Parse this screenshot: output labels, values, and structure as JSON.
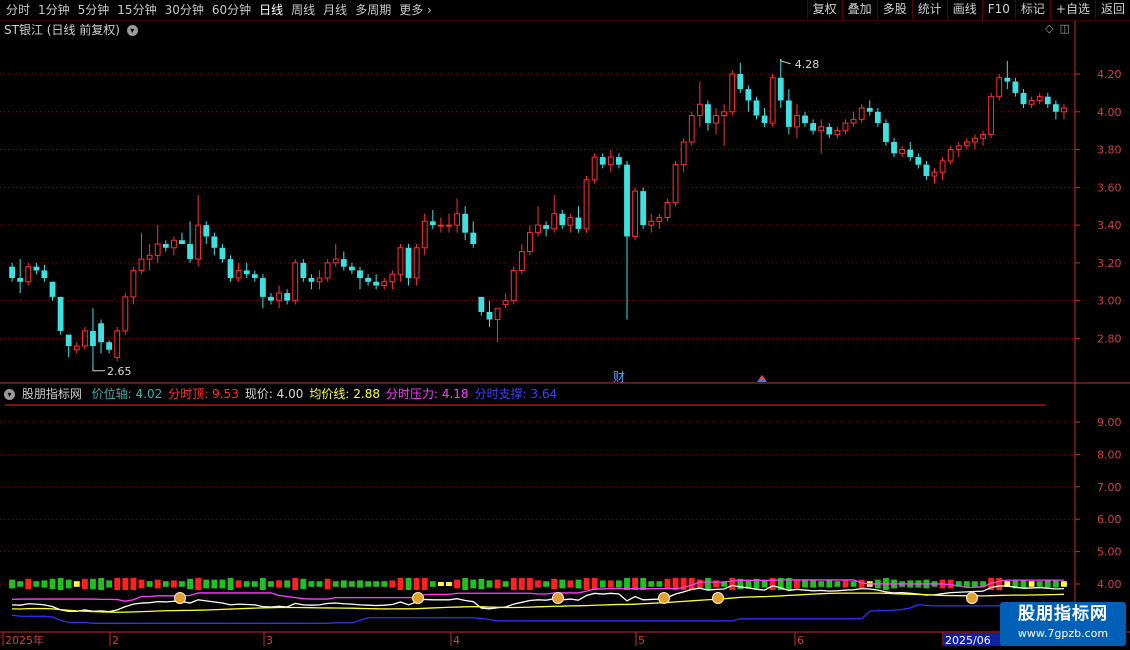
{
  "toolbar": {
    "periods": [
      "分时",
      "1分钟",
      "5分钟",
      "15分钟",
      "30分钟",
      "60分钟",
      "日线",
      "周线",
      "月线",
      "多周期",
      "更多"
    ],
    "active_period": "日线",
    "right_buttons": [
      "复权",
      "叠加",
      "多股",
      "统计",
      "画线",
      "F10",
      "标记",
      "+自选",
      "返回"
    ]
  },
  "chart_title": "ST银江 (日线 前复权)",
  "indicator": {
    "name": "股朋指标网",
    "items": [
      {
        "label": "价位轴: 4.02",
        "color": "#40b0b0"
      },
      {
        "label": "分时顶: 9.53",
        "color": "#ff3030"
      },
      {
        "label": "现价: 4.00",
        "color": "#d8d8d8"
      },
      {
        "label": "均价线: 2.88",
        "color": "#ffff40"
      },
      {
        "label": "分时压力: 4.18",
        "color": "#ff40ff"
      },
      {
        "label": "分时支撑: 3.64",
        "color": "#4040ff"
      }
    ]
  },
  "colors": {
    "up": "#ff3030",
    "down": "#40e0e0",
    "grid": "#7a0000",
    "axis": "#c03030"
  },
  "chart_data": {
    "type": "candlestick",
    "price_axis": {
      "ticks": [
        "4.20",
        "4.00",
        "3.80",
        "3.60",
        "3.40",
        "3.20",
        "3.00",
        "2.80"
      ],
      "ylim": [
        2.58,
        4.38
      ]
    },
    "indicator_axis": {
      "ticks": [
        "9.00",
        "8.00",
        "7.00",
        "6.00",
        "5.00",
        "4.00"
      ]
    },
    "x_labels": [
      "2025年",
      "2",
      "3",
      "4",
      "5",
      "6",
      "2025/06"
    ],
    "annotations": {
      "high": "4.28",
      "low": "2.65",
      "event": "财"
    },
    "candles": [
      [
        3.18,
        3.2,
        3.1,
        3.12
      ],
      [
        3.12,
        3.22,
        3.04,
        3.1
      ],
      [
        3.1,
        3.2,
        3.08,
        3.18
      ],
      [
        3.18,
        3.2,
        3.14,
        3.16
      ],
      [
        3.16,
        3.19,
        3.1,
        3.12
      ],
      [
        3.1,
        3.1,
        3.0,
        3.02
      ],
      [
        3.02,
        3.02,
        2.82,
        2.84
      ],
      [
        2.82,
        2.82,
        2.7,
        2.76
      ],
      [
        2.74,
        2.78,
        2.72,
        2.76
      ],
      [
        2.76,
        2.86,
        2.74,
        2.84
      ],
      [
        2.84,
        2.96,
        2.65,
        2.76
      ],
      [
        2.88,
        2.9,
        2.72,
        2.78
      ],
      [
        2.78,
        2.79,
        2.72,
        2.74
      ],
      [
        2.7,
        2.86,
        2.68,
        2.84
      ],
      [
        2.84,
        3.04,
        2.82,
        3.02
      ],
      [
        3.02,
        3.18,
        2.98,
        3.16
      ],
      [
        3.16,
        3.36,
        3.14,
        3.22
      ],
      [
        3.22,
        3.3,
        3.16,
        3.24
      ],
      [
        3.24,
        3.4,
        3.2,
        3.3
      ],
      [
        3.3,
        3.32,
        3.26,
        3.28
      ],
      [
        3.28,
        3.34,
        3.24,
        3.32
      ],
      [
        3.32,
        3.36,
        3.3,
        3.3
      ],
      [
        3.3,
        3.42,
        3.2,
        3.22
      ],
      [
        3.22,
        3.56,
        3.18,
        3.4
      ],
      [
        3.4,
        3.42,
        3.3,
        3.34
      ],
      [
        3.34,
        3.36,
        3.24,
        3.28
      ],
      [
        3.28,
        3.3,
        3.2,
        3.22
      ],
      [
        3.22,
        3.24,
        3.1,
        3.12
      ],
      [
        3.12,
        3.2,
        3.1,
        3.16
      ],
      [
        3.16,
        3.2,
        3.12,
        3.14
      ],
      [
        3.14,
        3.16,
        3.1,
        3.12
      ],
      [
        3.12,
        3.14,
        2.96,
        3.02
      ],
      [
        3.02,
        3.04,
        2.98,
        3.0
      ],
      [
        3.0,
        3.08,
        2.96,
        3.04
      ],
      [
        3.04,
        3.06,
        2.98,
        3.0
      ],
      [
        3.0,
        3.22,
        2.98,
        3.2
      ],
      [
        3.2,
        3.22,
        3.1,
        3.12
      ],
      [
        3.12,
        3.14,
        3.06,
        3.1
      ],
      [
        3.1,
        3.16,
        3.06,
        3.12
      ],
      [
        3.12,
        3.22,
        3.1,
        3.2
      ],
      [
        3.2,
        3.3,
        3.18,
        3.22
      ],
      [
        3.22,
        3.26,
        3.16,
        3.18
      ],
      [
        3.18,
        3.2,
        3.14,
        3.16
      ],
      [
        3.16,
        3.18,
        3.06,
        3.12
      ],
      [
        3.12,
        3.14,
        3.08,
        3.1
      ],
      [
        3.1,
        3.14,
        3.06,
        3.08
      ],
      [
        3.08,
        3.12,
        3.06,
        3.1
      ],
      [
        3.1,
        3.16,
        3.06,
        3.14
      ],
      [
        3.14,
        3.3,
        3.1,
        3.28
      ],
      [
        3.28,
        3.3,
        3.08,
        3.12
      ],
      [
        3.12,
        3.3,
        3.08,
        3.28
      ],
      [
        3.28,
        3.46,
        3.24,
        3.42
      ],
      [
        3.42,
        3.48,
        3.38,
        3.4
      ],
      [
        3.4,
        3.44,
        3.36,
        3.4
      ],
      [
        3.4,
        3.46,
        3.36,
        3.4
      ],
      [
        3.4,
        3.54,
        3.36,
        3.46
      ],
      [
        3.46,
        3.5,
        3.32,
        3.36
      ],
      [
        3.36,
        3.42,
        3.28,
        3.3
      ],
      [
        3.02,
        3.02,
        2.92,
        2.94
      ],
      [
        2.94,
        3.0,
        2.86,
        2.9
      ],
      [
        2.9,
        2.94,
        2.78,
        2.96
      ],
      [
        2.98,
        3.04,
        2.96,
        3.0
      ],
      [
        3.0,
        3.18,
        2.98,
        3.16
      ],
      [
        3.16,
        3.3,
        3.14,
        3.26
      ],
      [
        3.26,
        3.4,
        3.24,
        3.36
      ],
      [
        3.36,
        3.5,
        3.34,
        3.4
      ],
      [
        3.4,
        3.42,
        3.34,
        3.38
      ],
      [
        3.38,
        3.56,
        3.36,
        3.46
      ],
      [
        3.46,
        3.48,
        3.38,
        3.4
      ],
      [
        3.4,
        3.46,
        3.36,
        3.44
      ],
      [
        3.44,
        3.5,
        3.36,
        3.38
      ],
      [
        3.38,
        3.66,
        3.36,
        3.64
      ],
      [
        3.64,
        3.78,
        3.62,
        3.76
      ],
      [
        3.76,
        3.78,
        3.7,
        3.72
      ],
      [
        3.72,
        3.8,
        3.68,
        3.76
      ],
      [
        3.76,
        3.78,
        3.7,
        3.72
      ],
      [
        3.72,
        3.74,
        2.9,
        3.34
      ],
      [
        3.34,
        3.6,
        3.32,
        3.58
      ],
      [
        3.58,
        3.6,
        3.38,
        3.4
      ],
      [
        3.4,
        3.46,
        3.36,
        3.42
      ],
      [
        3.42,
        3.46,
        3.38,
        3.44
      ],
      [
        3.44,
        3.54,
        3.42,
        3.52
      ],
      [
        3.52,
        3.74,
        3.5,
        3.72
      ],
      [
        3.72,
        3.86,
        3.68,
        3.84
      ],
      [
        3.84,
        4.0,
        3.82,
        3.98
      ],
      [
        3.98,
        4.16,
        3.92,
        4.04
      ],
      [
        4.04,
        4.06,
        3.9,
        3.94
      ],
      [
        3.94,
        4.02,
        3.88,
        3.98
      ],
      [
        3.98,
        4.04,
        3.82,
        4.0
      ],
      [
        4.0,
        4.22,
        3.98,
        4.2
      ],
      [
        4.2,
        4.26,
        4.1,
        4.12
      ],
      [
        4.12,
        4.14,
        4.0,
        4.06
      ],
      [
        4.06,
        4.08,
        3.96,
        3.98
      ],
      [
        3.98,
        4.02,
        3.92,
        3.94
      ],
      [
        3.94,
        4.2,
        3.92,
        4.18
      ],
      [
        4.18,
        4.28,
        4.02,
        4.06
      ],
      [
        4.06,
        4.12,
        3.88,
        3.92
      ],
      [
        3.92,
        4.04,
        3.86,
        3.98
      ],
      [
        3.98,
        4.0,
        3.92,
        3.94
      ],
      [
        3.94,
        3.96,
        3.88,
        3.9
      ],
      [
        3.9,
        3.96,
        3.78,
        3.92
      ],
      [
        3.92,
        3.94,
        3.86,
        3.88
      ],
      [
        3.88,
        3.92,
        3.86,
        3.9
      ],
      [
        3.9,
        3.96,
        3.88,
        3.94
      ],
      [
        3.94,
        4.0,
        3.92,
        3.96
      ],
      [
        3.96,
        4.04,
        3.94,
        4.02
      ],
      [
        4.02,
        4.06,
        3.98,
        4.0
      ],
      [
        4.0,
        4.02,
        3.92,
        3.94
      ],
      [
        3.94,
        3.96,
        3.82,
        3.84
      ],
      [
        3.84,
        3.86,
        3.76,
        3.78
      ],
      [
        3.78,
        3.82,
        3.76,
        3.8
      ],
      [
        3.8,
        3.84,
        3.74,
        3.76
      ],
      [
        3.76,
        3.78,
        3.7,
        3.72
      ],
      [
        3.72,
        3.74,
        3.64,
        3.66
      ],
      [
        3.66,
        3.7,
        3.62,
        3.68
      ],
      [
        3.68,
        3.76,
        3.64,
        3.74
      ],
      [
        3.74,
        3.82,
        3.72,
        3.8
      ],
      [
        3.8,
        3.84,
        3.76,
        3.82
      ],
      [
        3.82,
        3.86,
        3.8,
        3.84
      ],
      [
        3.84,
        3.88,
        3.8,
        3.86
      ],
      [
        3.86,
        3.9,
        3.82,
        3.88
      ],
      [
        3.88,
        4.1,
        3.86,
        4.08
      ],
      [
        4.08,
        4.2,
        4.06,
        4.18
      ],
      [
        4.18,
        4.27,
        4.12,
        4.16
      ],
      [
        4.16,
        4.18,
        4.08,
        4.1
      ],
      [
        4.1,
        4.12,
        4.02,
        4.04
      ],
      [
        4.04,
        4.08,
        4.02,
        4.06
      ],
      [
        4.06,
        4.1,
        4.04,
        4.08
      ],
      [
        4.08,
        4.1,
        4.02,
        4.04
      ],
      [
        4.04,
        4.06,
        3.96,
        4.0
      ],
      [
        4.0,
        4.04,
        3.96,
        4.02
      ]
    ]
  }
}
